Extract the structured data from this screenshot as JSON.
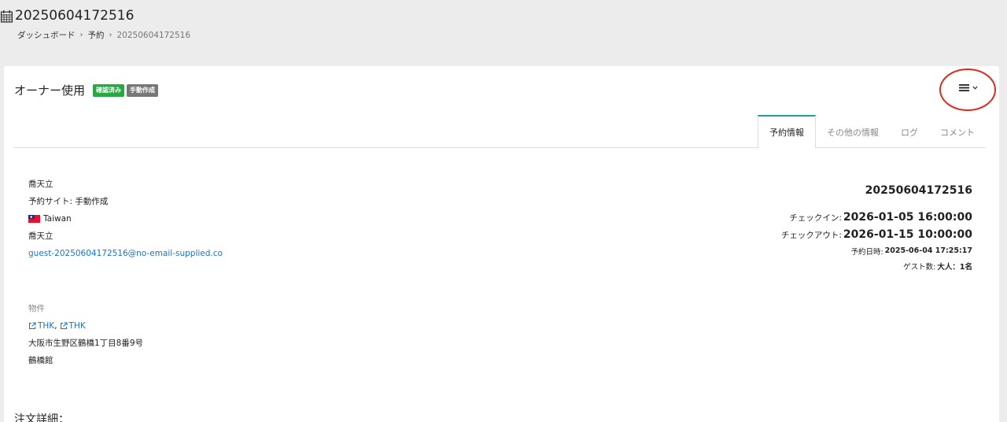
{
  "page": {
    "title": "20250604172516",
    "title_icon": "calendar-icon",
    "breadcrumb": [
      "ダッシュボード",
      "予約",
      "20250604172516"
    ],
    "breadcrumb_separator": "›"
  },
  "card": {
    "title": "オーナー使用",
    "badges": [
      {
        "label": "確認済み",
        "color": "#28a745"
      },
      {
        "label": "手動作成",
        "color": "#777777"
      }
    ],
    "menu_icon": "hamburger-menu-icon",
    "annotation_color": "#e02a1c"
  },
  "tabs": [
    {
      "label": "予約情報",
      "active": true
    },
    {
      "label": "その他の情報",
      "active": false
    },
    {
      "label": "ログ",
      "active": false
    },
    {
      "label": "コメント",
      "active": false
    }
  ],
  "guest": {
    "name": "喬天立",
    "site": "予約サイト: 手動作成",
    "country": "Taiwan",
    "country_flag": "taiwan-flag-icon",
    "contact_name": "喬天立",
    "email": "guest-20250604172516@no-email-supplied.co"
  },
  "reservation": {
    "number": "20250604172516",
    "checkin_label": "チェックイン:",
    "checkin_value": "2026-01-05 16:00:00",
    "checkout_label": "チェックアウト:",
    "checkout_value": "2026-01-15 10:00:00",
    "booked_label": "予約日時:",
    "booked_value": "2025-06-04 17:25:17",
    "guests_label": "ゲスト数:",
    "guests_value": "大人：1名"
  },
  "property": {
    "label": "物件",
    "links": [
      "THK",
      "THK"
    ],
    "link_separator": ",",
    "address": "大阪市生野区鶴橋1丁目8番9号",
    "building": "鶴橋館"
  },
  "order": {
    "title": "注文詳細："
  },
  "colors": {
    "accent_tab": "#1aa39a",
    "link": "#1a73c8",
    "background": "#ececec"
  }
}
